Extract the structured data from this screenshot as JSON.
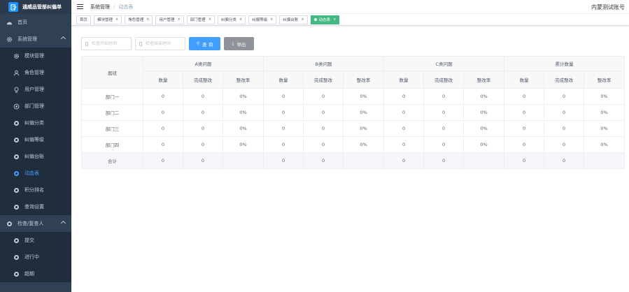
{
  "app": {
    "title": "通威品管部纠偏单"
  },
  "header": {
    "breadcrumb": [
      "系统管理",
      "动态表"
    ],
    "user": "内蒙测试账号"
  },
  "sidebar": {
    "items": [
      {
        "label": "首页",
        "icon": "dashboard-icon",
        "type": "top"
      },
      {
        "label": "系统管理",
        "icon": "gear-icon",
        "type": "group"
      },
      {
        "label": "模块管理",
        "icon": "gear-icon",
        "type": "sub"
      },
      {
        "label": "角色管理",
        "icon": "user-icon",
        "type": "sub"
      },
      {
        "label": "用户管理",
        "icon": "bulb-icon",
        "type": "sub"
      },
      {
        "label": "部门管理",
        "icon": "dept-icon",
        "type": "sub"
      },
      {
        "label": "纠偏分类",
        "icon": "circle-icon",
        "type": "sub"
      },
      {
        "label": "纠偏等级",
        "icon": "circle-icon",
        "type": "sub"
      },
      {
        "label": "纠偏台账",
        "icon": "circle-icon",
        "type": "sub"
      },
      {
        "label": "动态表",
        "icon": "circle-icon",
        "type": "sub",
        "active": true
      },
      {
        "label": "积分排名",
        "icon": "circle-icon",
        "type": "sub"
      },
      {
        "label": "查询设置",
        "icon": "circle-icon",
        "type": "sub"
      },
      {
        "label": "检查/复查人",
        "icon": "circle-icon",
        "type": "group"
      },
      {
        "label": "提交",
        "icon": "circle-icon",
        "type": "sub"
      },
      {
        "label": "进行中",
        "icon": "circle-icon",
        "type": "sub"
      },
      {
        "label": "超期",
        "icon": "circle-icon",
        "type": "sub"
      }
    ]
  },
  "tags": [
    {
      "label": "首页",
      "closable": false
    },
    {
      "label": "模块管理",
      "closable": true
    },
    {
      "label": "角色管理",
      "closable": true
    },
    {
      "label": "用户管理",
      "closable": true
    },
    {
      "label": "部门管理",
      "closable": true
    },
    {
      "label": "纠偏分类",
      "closable": true
    },
    {
      "label": "纠偏等级",
      "closable": true
    },
    {
      "label": "纠偏台账",
      "closable": true
    },
    {
      "label": "动态表",
      "closable": true,
      "active": true
    }
  ],
  "filters": {
    "start_placeholder": "检查开始时间",
    "end_placeholder": "检查结束时间",
    "query_label": "查 询",
    "export_label": "导出"
  },
  "table": {
    "dept_header": "届班",
    "groups": [
      "A类问题",
      "B类问题",
      "C类问题",
      "累计数量"
    ],
    "subheaders": [
      "数量",
      "完成整改",
      "整改率"
    ],
    "rows": [
      {
        "name": "部门一",
        "cells": [
          "0",
          "0",
          "0%",
          "0",
          "0",
          "0%",
          "0",
          "0",
          "0%",
          "0",
          "0",
          "0%"
        ]
      },
      {
        "name": "部门二",
        "cells": [
          "0",
          "0",
          "0%",
          "0",
          "0",
          "0%",
          "0",
          "0",
          "0%",
          "0",
          "0",
          "0%"
        ]
      },
      {
        "name": "部门三",
        "cells": [
          "0",
          "0",
          "0%",
          "0",
          "0",
          "0%",
          "0",
          "0",
          "0%",
          "0",
          "0",
          "0%"
        ]
      },
      {
        "name": "部门四",
        "cells": [
          "0",
          "0",
          "0%",
          "0",
          "0",
          "0%",
          "0",
          "0",
          "0%",
          "0",
          "0",
          "0%"
        ]
      }
    ],
    "total": {
      "name": "合计",
      "cells": [
        "0",
        "0",
        "",
        "0",
        "0",
        "",
        "0",
        "0",
        "",
        "0",
        "0",
        ""
      ]
    }
  },
  "colors": {
    "sidebar_bg": "#304156",
    "accent": "#409eff",
    "active_tag": "#42b983"
  }
}
